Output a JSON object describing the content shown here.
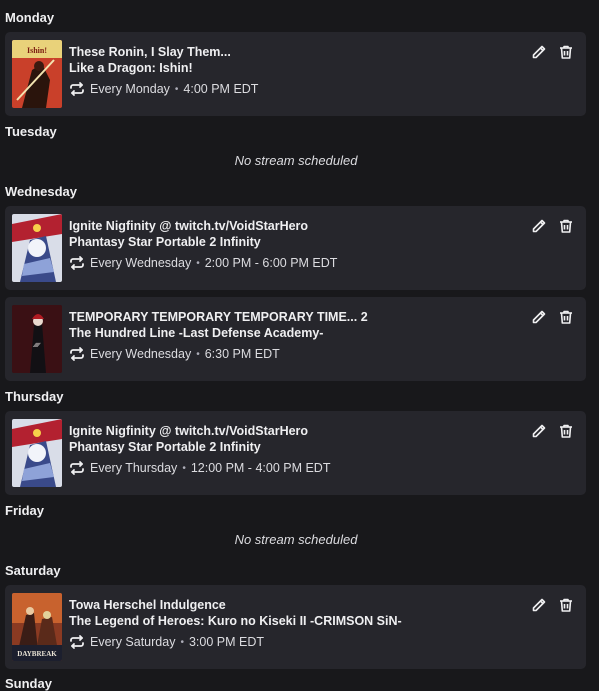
{
  "days": {
    "monday": {
      "label": "Monday"
    },
    "tuesday": {
      "label": "Tuesday",
      "empty": "No stream scheduled"
    },
    "wednesday": {
      "label": "Wednesday"
    },
    "thursday": {
      "label": "Thursday"
    },
    "friday": {
      "label": "Friday",
      "empty": "No stream scheduled"
    },
    "saturday": {
      "label": "Saturday"
    },
    "sunday": {
      "label": "Sunday"
    }
  },
  "segments": [
    {
      "title": "These Ronin, I Slay Them...",
      "game": "Like a Dragon: Ishin!",
      "recurrence": "Every Monday",
      "time": "4:00 PM EDT",
      "thumbnail_text": "Ishin!"
    },
    {
      "title": "Ignite Nigfinity @ twitch.tv/VoidStarHero",
      "game": "Phantasy Star Portable 2 Infinity",
      "recurrence": "Every Wednesday",
      "time": "2:00 PM - 6:00 PM EDT"
    },
    {
      "title": "TEMPORARY TEMPORARY TEMPORARY TIME... 2",
      "game": "The Hundred Line -Last Defense Academy-",
      "recurrence": "Every Wednesday",
      "time": "6:30 PM EDT"
    },
    {
      "title": "Ignite Nigfinity @ twitch.tv/VoidStarHero",
      "game": "Phantasy Star Portable 2 Infinity",
      "recurrence": "Every Thursday",
      "time": "12:00 PM - 4:00 PM EDT"
    },
    {
      "title": "Towa Herschel Indulgence",
      "game": "The Legend of Heroes: Kuro no Kiseki II -CRIMSON SiN-",
      "recurrence": "Every Saturday",
      "time": "3:00 PM EDT",
      "thumbnail_text": "DAYBREAK"
    }
  ],
  "icons": {
    "repeat": "repeat-icon",
    "edit": "pencil-icon",
    "delete": "trash-icon"
  },
  "colors": {
    "background": "#18181b",
    "card": "#26262c",
    "text": "#efeff1",
    "muted": "#adadb8"
  }
}
